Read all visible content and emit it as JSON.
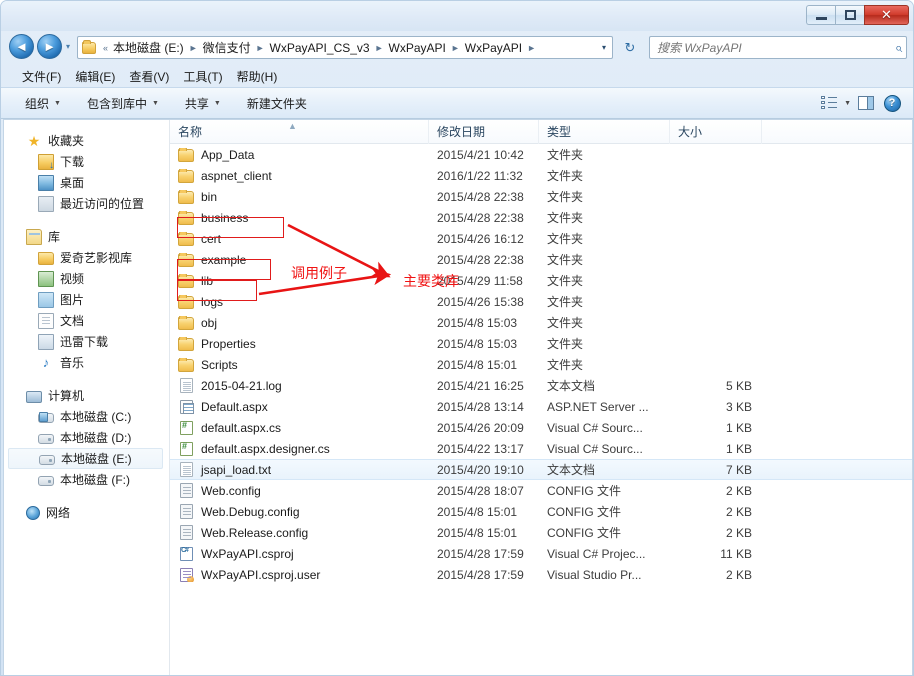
{
  "window": {
    "minimize_label": "最小化",
    "maximize_label": "最大化",
    "close_label": "✕"
  },
  "navbar": {
    "back_label": "◄",
    "forward_label": "►",
    "history_label": "▾",
    "breadcrumb_prefix": "«",
    "breadcrumbs": [
      "本地磁盘 (E:)",
      "微信支付",
      "WxPayAPI_CS_v3",
      "WxPayAPI",
      "WxPayAPI"
    ],
    "separator": "►",
    "address_dropdown": "▾",
    "refresh_label": "↻",
    "search_placeholder": "搜索 WxPayAPI",
    "search_value": "",
    "search_icon": "⌕"
  },
  "menubar": {
    "items": [
      {
        "label": "文件(F)"
      },
      {
        "label": "编辑(E)"
      },
      {
        "label": "查看(V)"
      },
      {
        "label": "工具(T)"
      },
      {
        "label": "帮助(H)"
      }
    ]
  },
  "toolbar": {
    "items": [
      {
        "label": "组织",
        "caret": "▼"
      },
      {
        "label": "包含到库中",
        "caret": "▼"
      },
      {
        "label": "共享",
        "caret": "▼"
      },
      {
        "label": "新建文件夹",
        "caret": ""
      }
    ],
    "view_caret": "▼",
    "help_label": "?"
  },
  "navpane": {
    "groups": [
      {
        "header": {
          "label": "收藏夹",
          "icon": "star-icon"
        },
        "items": [
          {
            "label": "下载",
            "icon": "download-icon"
          },
          {
            "label": "桌面",
            "icon": "desktop-icon"
          },
          {
            "label": "最近访问的位置",
            "icon": "recent-places-icon"
          }
        ]
      },
      {
        "header": {
          "label": "库",
          "icon": "library-icon"
        },
        "items": [
          {
            "label": "爱奇艺影视库",
            "icon": "folder-icon"
          },
          {
            "label": "视频",
            "icon": "video-icon"
          },
          {
            "label": "图片",
            "icon": "picture-icon"
          },
          {
            "label": "文档",
            "icon": "document-icon"
          },
          {
            "label": "迅雷下载",
            "icon": "thunder-download-icon"
          },
          {
            "label": "音乐",
            "icon": "music-icon"
          }
        ]
      },
      {
        "header": {
          "label": "计算机",
          "icon": "computer-icon"
        },
        "items": [
          {
            "label": "本地磁盘 (C:)",
            "icon": "system-drive-icon",
            "selected": false
          },
          {
            "label": "本地磁盘 (D:)",
            "icon": "drive-icon",
            "selected": false
          },
          {
            "label": "本地磁盘 (E:)",
            "icon": "drive-icon",
            "selected": true
          },
          {
            "label": "本地磁盘 (F:)",
            "icon": "drive-icon",
            "selected": false
          }
        ]
      },
      {
        "header": {
          "label": "网络",
          "icon": "network-icon"
        },
        "items": []
      }
    ]
  },
  "filelist": {
    "columns": {
      "name": "名称",
      "date": "修改日期",
      "type": "类型",
      "size": "大小"
    },
    "sort_indicator": "▲",
    "rows": [
      {
        "name": "App_Data",
        "date": "2015/4/21 10:42",
        "type": "文件夹",
        "size": "",
        "icon": "folder",
        "selected": false
      },
      {
        "name": "aspnet_client",
        "date": "2016/1/22 11:32",
        "type": "文件夹",
        "size": "",
        "icon": "folder",
        "selected": false
      },
      {
        "name": "bin",
        "date": "2015/4/28 22:38",
        "type": "文件夹",
        "size": "",
        "icon": "folder",
        "selected": false
      },
      {
        "name": "business",
        "date": "2015/4/28 22:38",
        "type": "文件夹",
        "size": "",
        "icon": "folder",
        "selected": false
      },
      {
        "name": "cert",
        "date": "2015/4/26 16:12",
        "type": "文件夹",
        "size": "",
        "icon": "folder",
        "selected": false
      },
      {
        "name": "example",
        "date": "2015/4/28 22:38",
        "type": "文件夹",
        "size": "",
        "icon": "folder",
        "selected": false
      },
      {
        "name": "lib",
        "date": "2015/4/29 11:58",
        "type": "文件夹",
        "size": "",
        "icon": "folder",
        "selected": false
      },
      {
        "name": "logs",
        "date": "2015/4/26 15:38",
        "type": "文件夹",
        "size": "",
        "icon": "folder",
        "selected": false
      },
      {
        "name": "obj",
        "date": "2015/4/8 15:03",
        "type": "文件夹",
        "size": "",
        "icon": "folder",
        "selected": false
      },
      {
        "name": "Properties",
        "date": "2015/4/8 15:03",
        "type": "文件夹",
        "size": "",
        "icon": "folder",
        "selected": false
      },
      {
        "name": "Scripts",
        "date": "2015/4/8 15:01",
        "type": "文件夹",
        "size": "",
        "icon": "folder",
        "selected": false
      },
      {
        "name": "2015-04-21.log",
        "date": "2015/4/21 16:25",
        "type": "文本文档",
        "size": "5 KB",
        "icon": "txt",
        "selected": false
      },
      {
        "name": "Default.aspx",
        "date": "2015/4/28 13:14",
        "type": "ASP.NET Server ...",
        "size": "3 KB",
        "icon": "aspx",
        "selected": false
      },
      {
        "name": "default.aspx.cs",
        "date": "2015/4/26 20:09",
        "type": "Visual C# Sourc...",
        "size": "1 KB",
        "icon": "cs",
        "selected": false
      },
      {
        "name": "default.aspx.designer.cs",
        "date": "2015/4/22 13:17",
        "type": "Visual C# Sourc...",
        "size": "1 KB",
        "icon": "cs",
        "selected": false
      },
      {
        "name": "jsapi_load.txt",
        "date": "2015/4/20 19:10",
        "type": "文本文档",
        "size": "7 KB",
        "icon": "txt",
        "selected": true
      },
      {
        "name": "Web.config",
        "date": "2015/4/28 18:07",
        "type": "CONFIG 文件",
        "size": "2 KB",
        "icon": "config",
        "selected": false
      },
      {
        "name": "Web.Debug.config",
        "date": "2015/4/8 15:01",
        "type": "CONFIG 文件",
        "size": "2 KB",
        "icon": "config",
        "selected": false
      },
      {
        "name": "Web.Release.config",
        "date": "2015/4/8 15:01",
        "type": "CONFIG 文件",
        "size": "2 KB",
        "icon": "config",
        "selected": false
      },
      {
        "name": "WxPayAPI.csproj",
        "date": "2015/4/28 17:59",
        "type": "Visual C# Projec...",
        "size": "11 KB",
        "icon": "csproj",
        "selected": false
      },
      {
        "name": "WxPayAPI.csproj.user",
        "date": "2015/4/28 17:59",
        "type": "Visual Studio Pr...",
        "size": "2 KB",
        "icon": "vsuser",
        "selected": false
      }
    ]
  },
  "annotations": {
    "color": "#f01414",
    "labels": [
      {
        "text": "调用例子"
      },
      {
        "text": "主要类库"
      }
    ],
    "highlighted_folders": [
      "business",
      "example",
      "lib"
    ]
  }
}
